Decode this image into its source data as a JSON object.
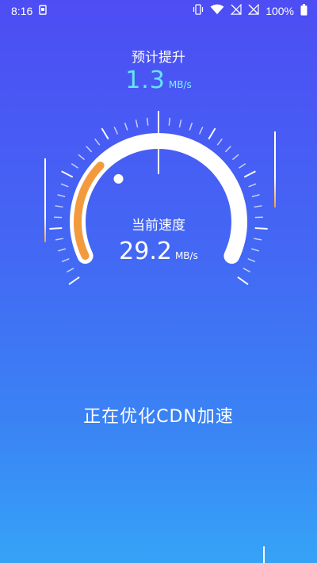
{
  "status_bar": {
    "time": "8:16",
    "battery": "100%",
    "icons": [
      "sim-card-icon",
      "vibrate-icon",
      "wifi-icon",
      "no-signal-icon",
      "no-signal-icon",
      "battery-icon"
    ]
  },
  "predicted": {
    "title": "预计提升",
    "value": "1.3",
    "unit": "MB/s"
  },
  "current": {
    "label": "当前速度",
    "value": "29.2",
    "unit": "MB/s",
    "progress_fraction": 0.3
  },
  "status_message": "正在优化CDN加速",
  "colors": {
    "accent_orange": "#f39a3e",
    "accent_cyan": "#62e7f2",
    "gauge_track": "#ffffff"
  }
}
